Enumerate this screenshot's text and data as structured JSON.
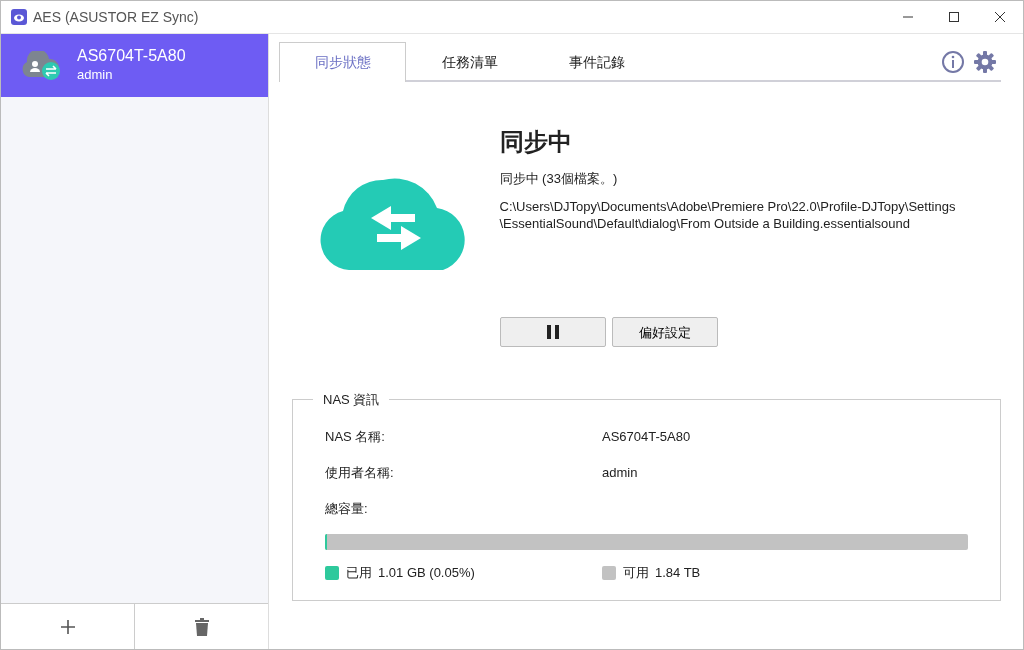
{
  "window": {
    "title": "AES (ASUSTOR EZ Sync)"
  },
  "sidebar": {
    "devices": [
      {
        "name": "AS6704T-5A80",
        "user": "admin",
        "selected": true
      }
    ]
  },
  "tabs": [
    {
      "label": "同步狀態",
      "selected": true
    },
    {
      "label": "任務清單",
      "selected": false
    },
    {
      "label": "事件記錄",
      "selected": false
    }
  ],
  "status": {
    "title": "同步中",
    "summary": "同步中 (33個檔案。)",
    "path_lines": [
      "C:\\Users\\DJTopy\\Documents\\Adobe\\Premiere Pro\\22.0\\Profile-DJTopy\\Settings",
      "\\EssentialSound\\Default\\dialog\\From Outside a Building.essentialsound"
    ]
  },
  "buttons": {
    "preferences": "偏好設定"
  },
  "nas_info": {
    "title": "NAS 資訊",
    "rows": [
      {
        "label": "NAS 名稱:",
        "value": "AS6704T-5A80"
      },
      {
        "label": "使用者名稱:",
        "value": "admin"
      }
    ],
    "capacity_label": "總容量:",
    "level": 0.0005,
    "legend": [
      {
        "label": "已用",
        "value": "1.01 GB (0.05%)",
        "color": "#2ec99c"
      },
      {
        "label": "可用",
        "value": "1.84 TB",
        "color": "#c2c2c2"
      }
    ]
  }
}
